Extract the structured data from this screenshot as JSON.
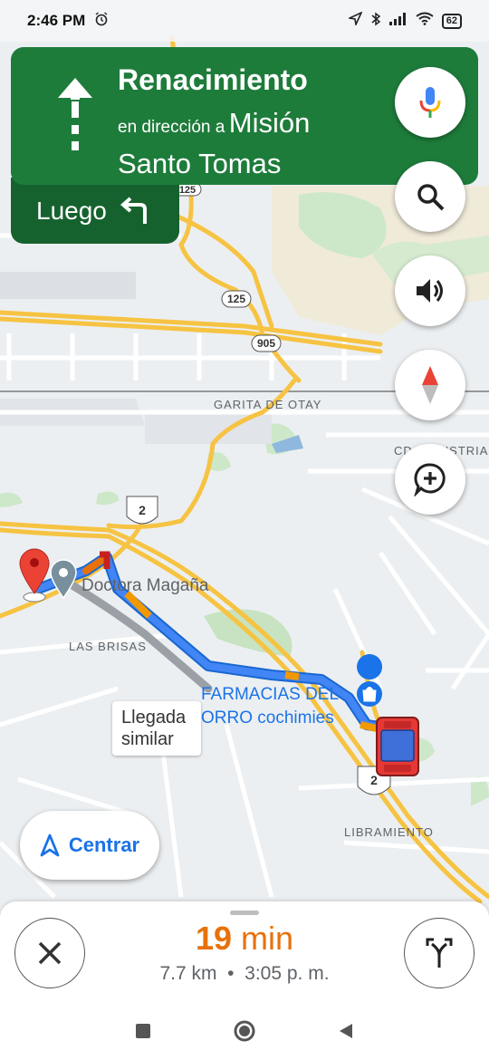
{
  "status": {
    "time": "2:46 PM",
    "battery": "62"
  },
  "navigation": {
    "street": "Renacimiento",
    "toward_prefix": "en dirección a",
    "destination": "Misión Santo Tomas",
    "then_label": "Luego"
  },
  "map": {
    "labels": {
      "garita": "GARITA DE OTAY",
      "industrial": "CD INDUSTRIAL",
      "las_brisas": "LAS BRISAS",
      "libramiento": "LIBRAMIENTO",
      "doctora": "Doctora Magaña",
      "farmacias_1": "FARMACIAS DEL",
      "farmacias_2": "ORRO cochimies"
    },
    "shields": {
      "r125a": "125",
      "r125b": "125",
      "r905": "905",
      "r2a": "2",
      "r2b": "2"
    },
    "route_tip_line1": "Llegada",
    "route_tip_line2": "similar"
  },
  "recenter_label": "Centrar",
  "trip": {
    "duration_value": "19",
    "duration_unit": "min",
    "distance": "7.7 km",
    "separator": "•",
    "arrival": "3:05 p. m."
  },
  "icons": {
    "mic": "mic-icon",
    "search": "search-icon",
    "sound": "volume-icon",
    "compass": "compass-icon",
    "report": "add-report-icon",
    "close": "close-icon",
    "alternates": "alternate-routes-icon"
  },
  "colors": {
    "nav_green": "#1e7c3b",
    "nav_dark_green": "#16622e",
    "route_blue": "#4285f4",
    "eta_orange": "#e8710a",
    "accent_blue": "#1a73e8"
  }
}
